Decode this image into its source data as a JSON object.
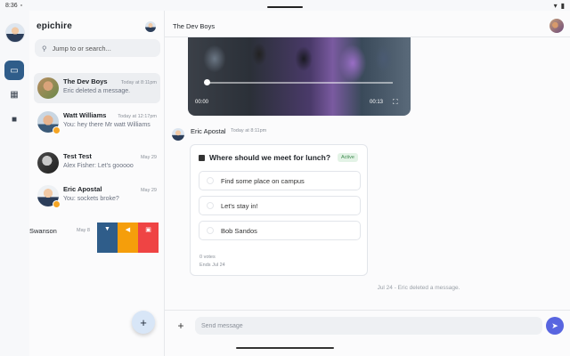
{
  "status_bar": {
    "time": "8:36",
    "wifi_icon": "wifi-icon",
    "battery_icon": "battery-icon"
  },
  "app": {
    "name": "epichire"
  },
  "search": {
    "placeholder": "Jump to or search..."
  },
  "conversations": [
    {
      "name": "The Dev Boys",
      "time": "Today at 8:11pm",
      "message": "Eric deleted a message."
    },
    {
      "name": "Watt Williams",
      "time": "Today at 12:17pm",
      "message": "You: hey there Mr watt Williams"
    },
    {
      "name": "Test Test",
      "time": "May 29",
      "message": "Alex Fisher: Let's gooooo"
    },
    {
      "name": "Eric Apostal",
      "time": "May 29",
      "message": "You: sockets broke?"
    }
  ],
  "swiped_conversation": {
    "name": "Swanson",
    "time": "May 8"
  },
  "swipe_actions": [
    {
      "icon": "pin-icon",
      "color": "#2f5d8a"
    },
    {
      "icon": "mute-icon",
      "color": "#f59e0b"
    },
    {
      "icon": "delete-icon",
      "color": "#ef4444"
    }
  ],
  "chat": {
    "title": "The Dev Boys",
    "video": {
      "current_time": "00:00",
      "duration": "00:13"
    },
    "sender": {
      "name": "Eric Apostal",
      "time": "Today at 8:11pm"
    },
    "poll": {
      "question": "Where should we meet for lunch?",
      "status": "Active",
      "options": [
        "Find some place on campus",
        "Let's stay in!",
        "Bob Sandos"
      ],
      "votes": "0 votes",
      "ends": "Ends Jul 24"
    },
    "system_message": "Jul 24 - Eric deleted a message.",
    "composer_placeholder": "Send message"
  },
  "colors": {
    "accent": "#2f5d8a",
    "send": "#5865e0",
    "active_badge": "#3f8a4f"
  }
}
